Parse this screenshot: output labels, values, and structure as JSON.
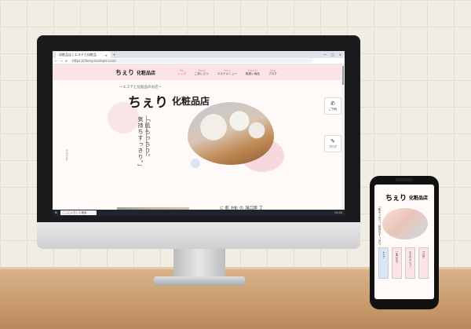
{
  "browser": {
    "tab_title": "化粧品店 | エステと化粧品",
    "tab_close": "×",
    "new_tab": "+",
    "window_controls": [
      "—",
      "□",
      "×"
    ],
    "nav_buttons": [
      "←",
      "→",
      "⟳"
    ],
    "url": "https://cheiry.example.com/"
  },
  "site": {
    "logo_mark": "ちぇり",
    "name": "化粧品店",
    "tagline": "〜エステと化粧品のお店〜",
    "catch_lines": [
      "「肌もっちり。",
      "気持ちすっきり。」"
    ],
    "scroll_label": "SCROLL"
  },
  "nav": [
    {
      "en": "Top",
      "jp": "トップ",
      "active": true
    },
    {
      "en": "About",
      "jp": "ごあいさつ",
      "active": false
    },
    {
      "en": "Menu",
      "jp": "エステメニュー",
      "active": false
    },
    {
      "en": "Product",
      "jp": "取扱い商品",
      "active": false
    },
    {
      "en": "Blog",
      "jp": "ブログ",
      "active": false
    }
  ],
  "side_buttons": [
    {
      "icon": "phone-icon",
      "glyph": "✆",
      "label": "ご予約"
    },
    {
      "icon": "edit-icon",
      "glyph": "✎",
      "label": "ブログ"
    }
  ],
  "below": {
    "heading_a": "お肌に",
    "heading_b": "丁寧に",
    "heading_c": "江深の化"
  },
  "taskbar": {
    "search_placeholder": "ここに入力して検索",
    "clock": "13:00"
  },
  "phone": {
    "logo_mark": "ちぇり",
    "name": "化粧品店",
    "catch": "「肌もっちり。気持ちすっきり。」",
    "cards": [
      "トップ",
      "ごあいさつ",
      "エステメニュー",
      "ブログ"
    ]
  },
  "colors": {
    "accent_pink": "#fbe3e6",
    "nav_en": "#e0879a",
    "taskbar": "#1f2430"
  }
}
